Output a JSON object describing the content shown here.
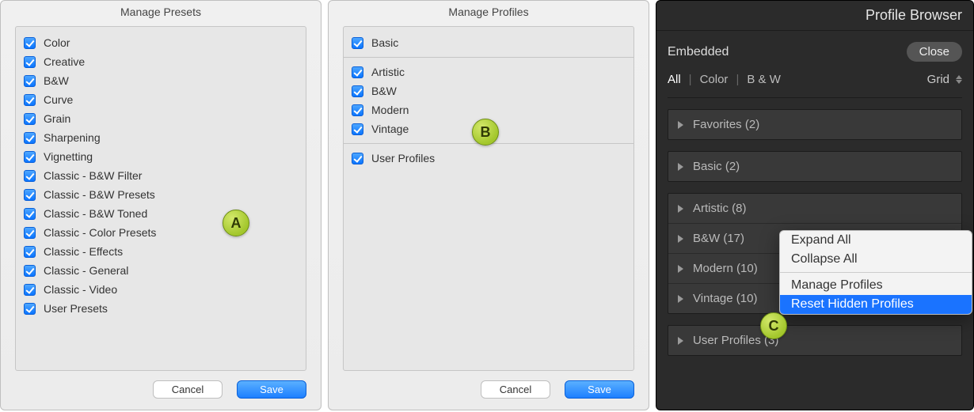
{
  "panelA": {
    "title": "Manage Presets",
    "badge": "A",
    "items": [
      "Color",
      "Creative",
      "B&W",
      "Curve",
      "Grain",
      "Sharpening",
      "Vignetting",
      "Classic - B&W Filter",
      "Classic - B&W Presets",
      "Classic - B&W Toned",
      "Classic - Color Presets",
      "Classic - Effects",
      "Classic - General",
      "Classic - Video",
      "User Presets"
    ],
    "cancel": "Cancel",
    "save": "Save"
  },
  "panelB": {
    "title": "Manage Profiles",
    "badge": "B",
    "group1": [
      "Basic"
    ],
    "group2": [
      "Artistic",
      "B&W",
      "Modern",
      "Vintage"
    ],
    "group3": [
      "User Profiles"
    ],
    "cancel": "Cancel",
    "save": "Save"
  },
  "dark": {
    "title": "Profile Browser",
    "embedded": "Embedded",
    "close": "Close",
    "filters": {
      "all": "All",
      "color": "Color",
      "bw": "B & W"
    },
    "view": "Grid",
    "g1": [
      "Favorites (2)"
    ],
    "g2": [
      "Basic (2)"
    ],
    "g3": [
      "Artistic (8)",
      "B&W (17)",
      "Modern (10)",
      "Vintage (10)"
    ],
    "g4": [
      "User Profiles (3)"
    ],
    "badge": "C",
    "menu": {
      "expand": "Expand All",
      "collapse": "Collapse All",
      "manage": "Manage Profiles",
      "reset": "Reset Hidden Profiles"
    }
  }
}
